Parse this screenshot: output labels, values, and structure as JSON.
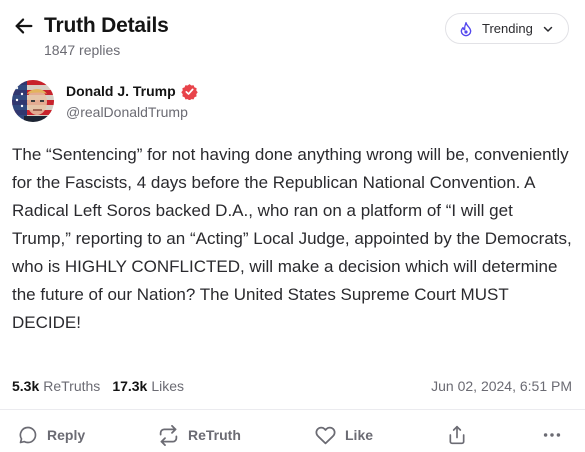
{
  "header": {
    "title": "Truth Details",
    "subtitle": "1847 replies",
    "trending_label": "Trending"
  },
  "author": {
    "name": "Donald J. Trump",
    "handle": "@realDonaldTrump",
    "verified_color": "#e8434a"
  },
  "post": {
    "text": "The “Sentencing” for not having done anything wrong will be, conveniently for the Fascists, 4 days before the Republican National Convention. A Radical Left Soros backed D.A., who ran on a platform of “I will get Trump,” reporting to an “Acting” Local Judge, appointed by the Democrats, who is HIGHLY CONFLICTED, will make a decision which will determine the future of our Nation? The United States Supreme Court MUST DECIDE!"
  },
  "stats": {
    "retruths_count": "5.3k",
    "retruths_label": "ReTruths",
    "likes_count": "17.3k",
    "likes_label": "Likes",
    "timestamp": "Jun 02, 2024, 6:51 PM"
  },
  "actions": {
    "reply_label": "Reply",
    "retruth_label": "ReTruth",
    "like_label": "Like"
  },
  "icons": {
    "back": "arrow-left-icon",
    "trending": "flame-icon",
    "chevron": "chevron-down-icon",
    "verified": "verified-badge-icon",
    "reply": "comment-icon",
    "retruth": "repost-icon",
    "like": "heart-icon",
    "share": "share-icon",
    "more": "more-horizontal-icon"
  },
  "colors": {
    "accent": "#5448ee",
    "muted_text": "#6b6b73"
  }
}
